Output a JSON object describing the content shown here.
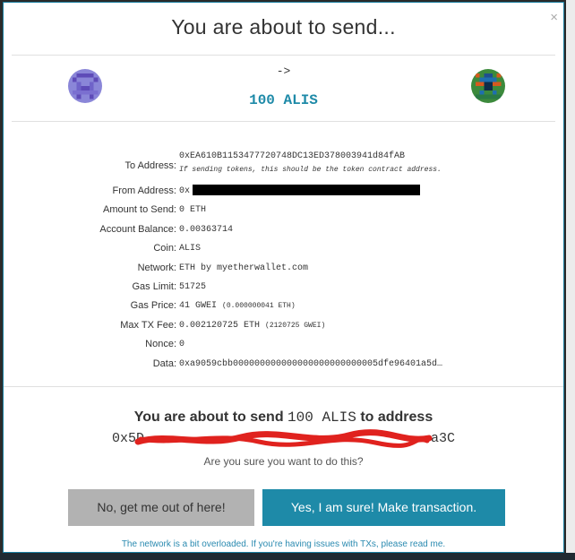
{
  "modal": {
    "title": "You are about to send...",
    "close_glyph": "×",
    "arrow": "->",
    "amount": "100 ALIS"
  },
  "details": {
    "to_address": {
      "label": "To Address:",
      "value": "0xEA610B1153477720748DC13ED378003941d84fAB",
      "hint": "If sending tokens, this should be the token contract address."
    },
    "from_address": {
      "label": "From Address:",
      "value": "0x"
    },
    "amount_to_send": {
      "label": "Amount to Send:",
      "value": "0 ETH"
    },
    "account_balance": {
      "label": "Account Balance:",
      "value": "0.00363714"
    },
    "coin": {
      "label": "Coin:",
      "value": "ALIS"
    },
    "network": {
      "label": "Network:",
      "value": "ETH by myetherwallet.com"
    },
    "gas_limit": {
      "label": "Gas Limit:",
      "value": "51725"
    },
    "gas_price": {
      "label": "Gas Price:",
      "value": "41 GWEI",
      "sub": "(0.000000041 ETH)"
    },
    "max_tx_fee": {
      "label": "Max TX Fee:",
      "value": "0.002120725 ETH",
      "sub": "(2120725 GWEI)"
    },
    "nonce": {
      "label": "Nonce:",
      "value": "0"
    },
    "data": {
      "label": "Data:",
      "value": "0xa9059cbb000000000000000000000000005dfe96401a5d…"
    }
  },
  "confirmation": {
    "prefix": "You are about to send",
    "amount": "100 ALIS",
    "suffix": "to address",
    "address_start": "0x5D",
    "address_end": "a3C",
    "question": "Are you sure you want to do this?"
  },
  "buttons": {
    "no_label": "No, get me out of here!",
    "yes_label": "Yes, I am sure! Make transaction."
  },
  "notice": "The network is a bit overloaded. If you're having issues with TXs, please read me.",
  "colors": {
    "accent": "#1e8aa8",
    "cancel": "#b2b2b2",
    "text": "#333333"
  }
}
